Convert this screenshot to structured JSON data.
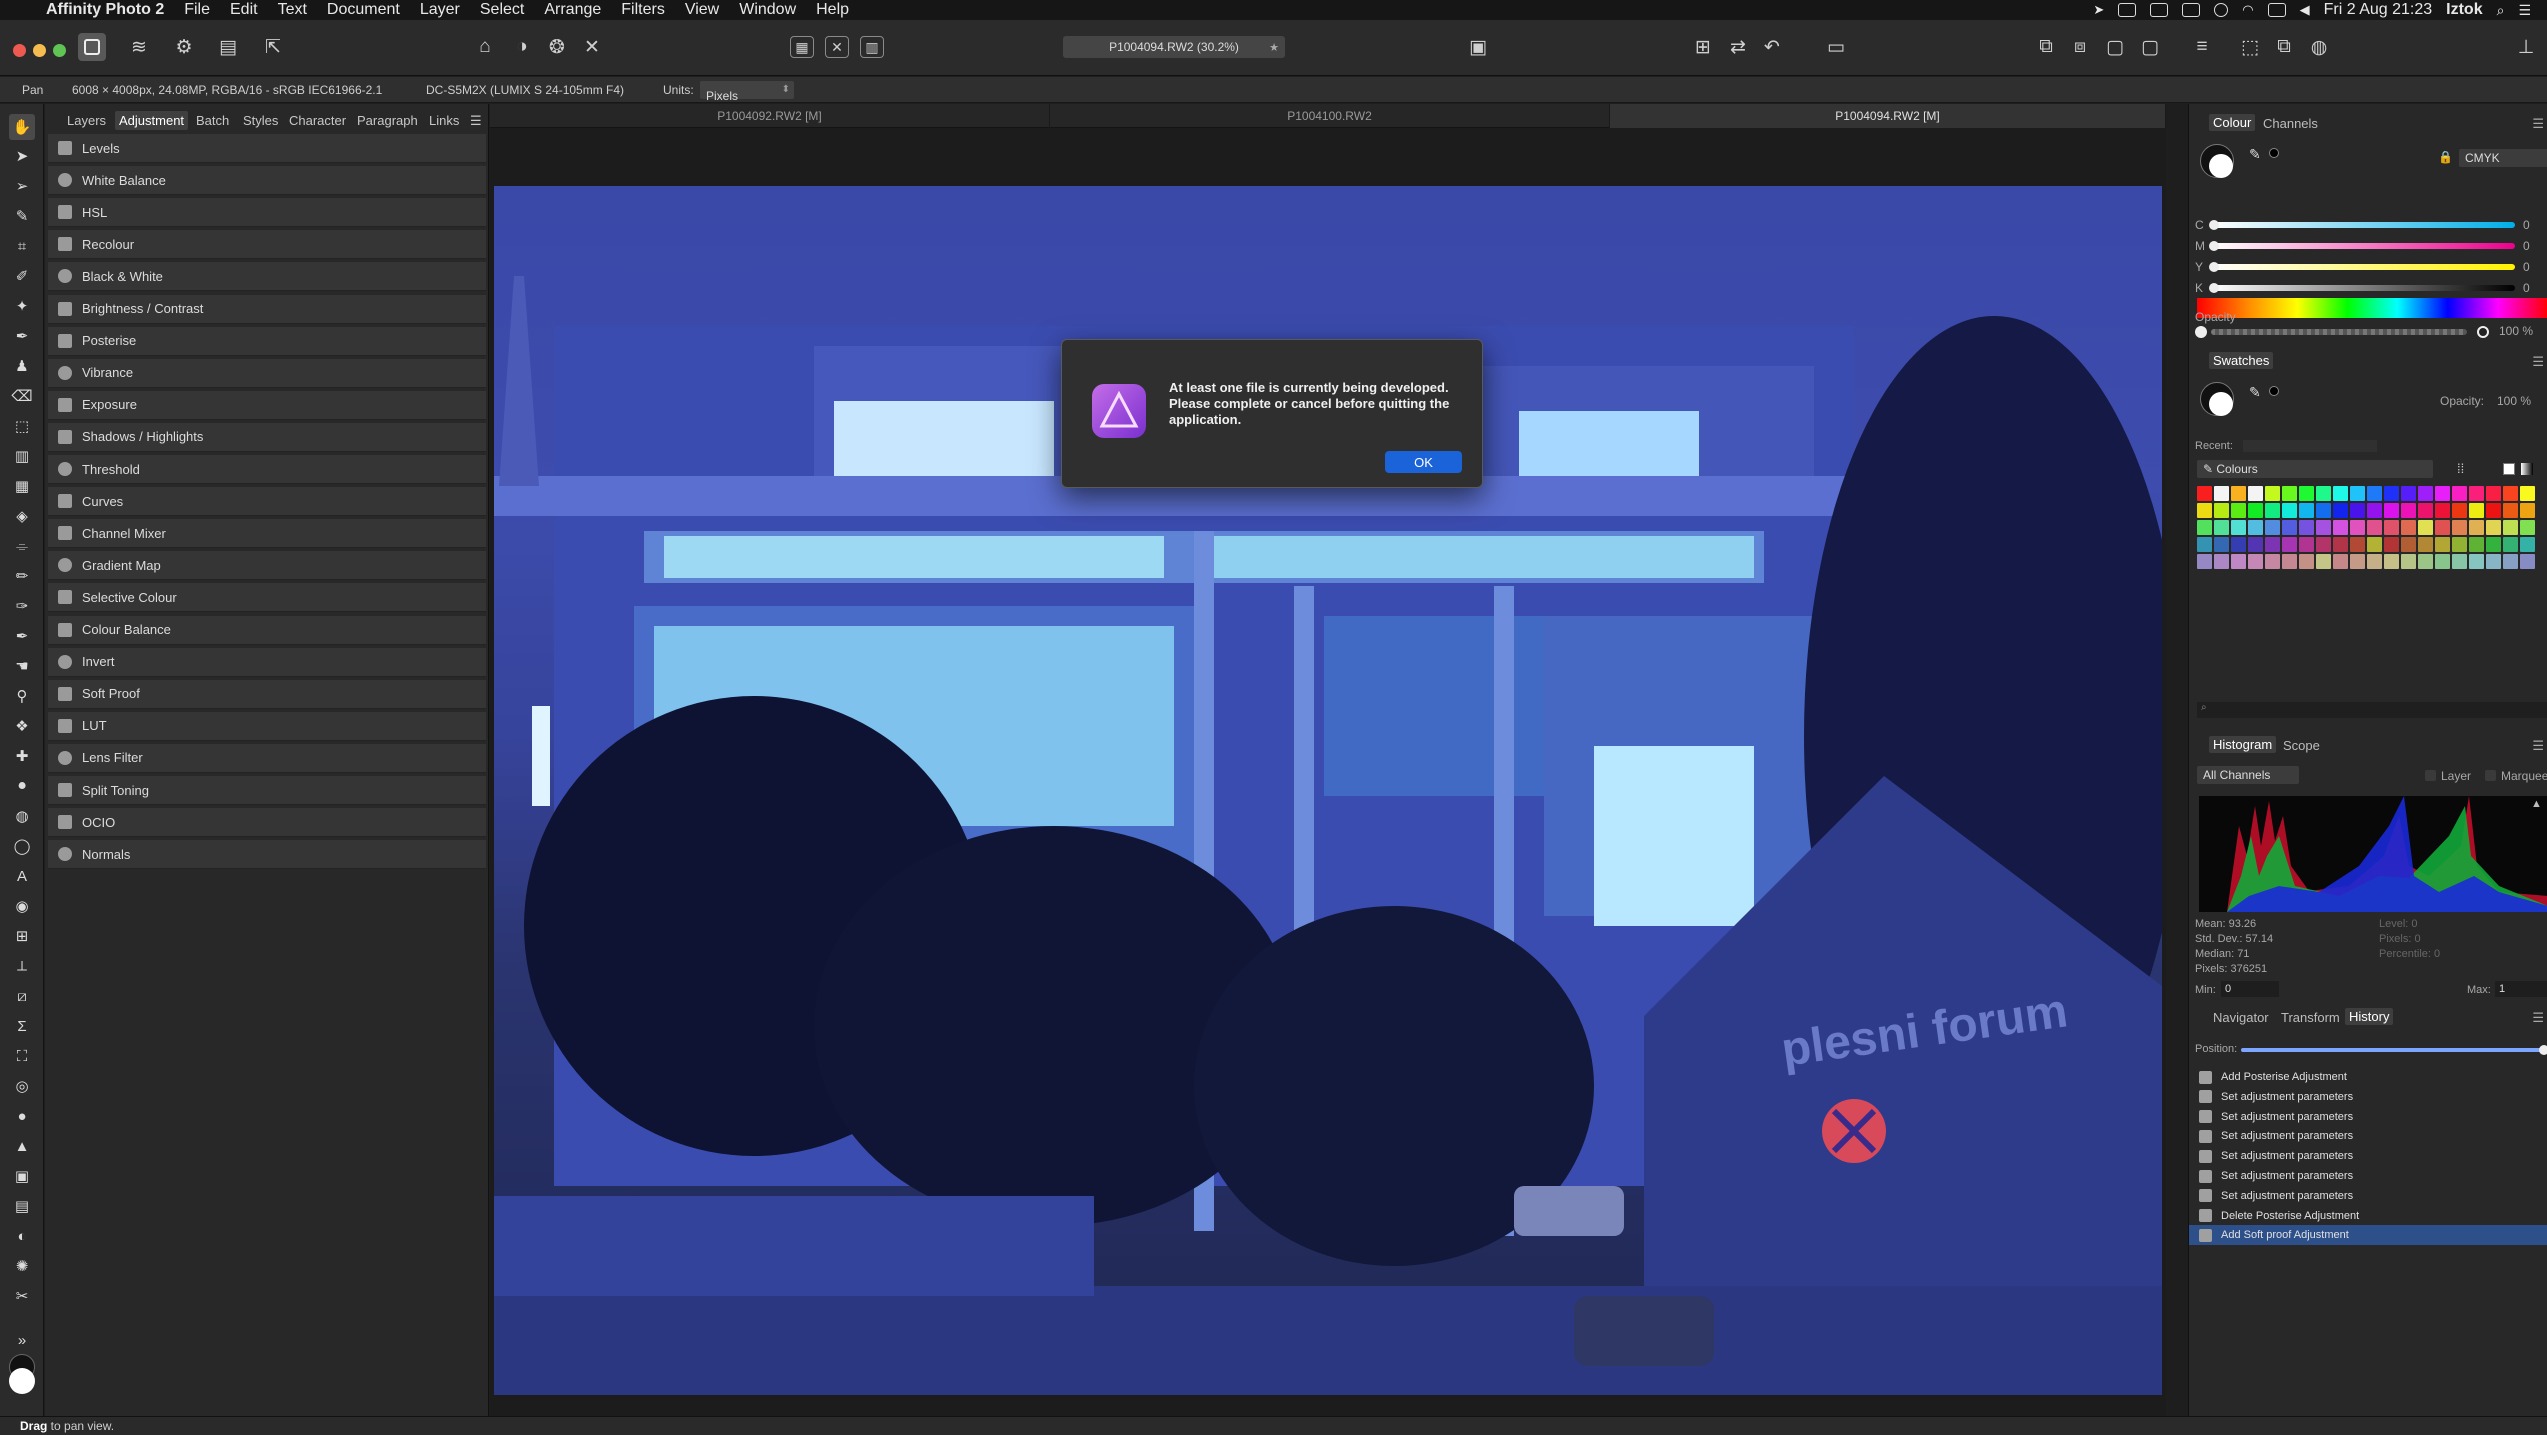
{
  "menubar": {
    "app_name": "Affinity Photo 2",
    "items": [
      "File",
      "Edit",
      "Text",
      "Document",
      "Layer",
      "Select",
      "Arrange",
      "Filters",
      "View",
      "Window",
      "Help"
    ],
    "clock": "Fri 2 Aug  21:23",
    "user": "Iztok"
  },
  "toolbar": {
    "document_title": "P1004094.RW2 (30.2%)"
  },
  "context": {
    "tool_name": "Pan",
    "image_info": "6008 × 4008px, 24.08MP, RGBA/16 - sRGB IEC61966-2.1",
    "camera": "DC-S5M2X (LUMIX S 24-105mm F4)",
    "units_label": "Units:",
    "units_value": "Pixels"
  },
  "left_panel": {
    "tabs": [
      "Layers",
      "Adjustment",
      "Batch",
      "Styles",
      "Character",
      "Paragraph",
      "Links"
    ],
    "active_tab": "Adjustment",
    "adjustments": [
      "Levels",
      "White Balance",
      "HSL",
      "Recolour",
      "Black & White",
      "Brightness / Contrast",
      "Posterise",
      "Vibrance",
      "Exposure",
      "Shadows / Highlights",
      "Threshold",
      "Curves",
      "Channel Mixer",
      "Gradient Map",
      "Selective Colour",
      "Colour Balance",
      "Invert",
      "Soft Proof",
      "LUT",
      "Lens Filter",
      "Split Toning",
      "OCIO",
      "Normals"
    ]
  },
  "document_tabs": [
    "P1004092.RW2 [M]",
    "P1004100.RW2",
    "P1004094.RW2 [M]"
  ],
  "active_document_tab": 2,
  "dialog": {
    "message": "At least one file is currently being developed. Please complete or cancel before quitting the application.",
    "ok_label": "OK"
  },
  "colour_panel": {
    "tabs": [
      "Colour",
      "Channels"
    ],
    "mode": "CMYK",
    "channels": [
      {
        "label": "C",
        "value": "0"
      },
      {
        "label": "M",
        "value": "0"
      },
      {
        "label": "Y",
        "value": "0"
      },
      {
        "label": "K",
        "value": "0"
      }
    ],
    "opacity_label": "Opacity",
    "opacity_value": "100 %"
  },
  "swatches_panel": {
    "title": "Swatches",
    "opacity_label": "Opacity:",
    "opacity_value": "100 %",
    "recent_label": "Recent:",
    "palette_name": "Colours"
  },
  "histogram_panel": {
    "tabs": [
      "Histogram",
      "Scope"
    ],
    "channel_select": "All Channels",
    "layer_label": "Layer",
    "marquee_label": "Marquee",
    "stats_left": [
      "Mean: 93.26",
      "Std. Dev.: 57.14",
      "Median: 71",
      "Pixels: 376251"
    ],
    "stats_right": [
      "Level: 0",
      "Pixels: 0",
      "Percentile: 0"
    ],
    "min_label": "Min:",
    "min_value": "0",
    "max_label": "Max:",
    "max_value": "1"
  },
  "history_panel": {
    "tabs": [
      "Navigator",
      "Transform",
      "History"
    ],
    "position_label": "Position:",
    "entries": [
      "Add Posterise Adjustment",
      "Set adjustment parameters",
      "Set adjustment parameters",
      "Set adjustment parameters",
      "Set adjustment parameters",
      "Set adjustment parameters",
      "Set adjustment parameters",
      "Delete Posterise Adjustment",
      "Add Soft proof Adjustment"
    ],
    "selected_index": 8
  },
  "photo": {
    "sign_text": "plesni forum"
  },
  "statusbar": {
    "bold": "Drag",
    "rest": " to pan view."
  }
}
